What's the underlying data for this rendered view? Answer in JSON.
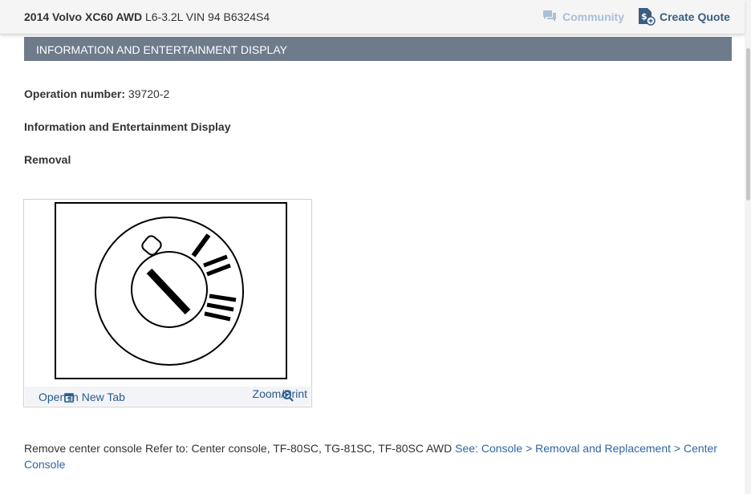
{
  "header": {
    "vehicle_model": "2014 Volvo XC60 AWD",
    "vehicle_engine": "L6-3.2L VIN 94 B6324S4",
    "community_label": "Community",
    "create_quote_label": "Create Quote",
    "community_color": "#a9bfd6",
    "accent_color": "#3a5d82"
  },
  "section": {
    "title": "INFORMATION AND ENTERTAINMENT DISPLAY",
    "header_bg": "#6e7b8b"
  },
  "procedure": {
    "operation_label": "Operation number:",
    "operation_value": "39720-2",
    "heading": "Information and Entertainment Display",
    "step_title": "Removal"
  },
  "figure": {
    "open_tab_label": "Open In New Tab",
    "zoom_label": "Zoom/Print"
  },
  "instruction": {
    "text": "Remove center console Refer to: Center console, TF-80SC, TG-81SC, TF-80SC AWD",
    "link_text": "See: Console > Removal and Replacement > Center Console",
    "link_color": "#2f66a3"
  }
}
